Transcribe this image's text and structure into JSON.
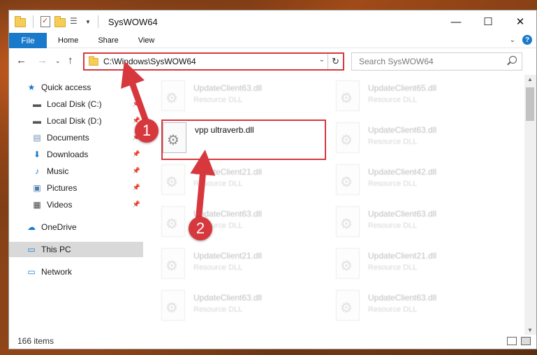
{
  "window": {
    "title": "SysWOW64"
  },
  "ribbon": {
    "tabs": [
      "File",
      "Home",
      "Share",
      "View"
    ]
  },
  "address": {
    "path": "C:\\Windows\\SysWOW64",
    "search_placeholder": "Search SysWOW64"
  },
  "nav": {
    "quick_access": "Quick access",
    "items": [
      "Local Disk (C:)",
      "Local Disk (D:)",
      "Documents",
      "Downloads",
      "Music",
      "Pictures",
      "Videos"
    ],
    "onedrive": "OneDrive",
    "this_pc": "This PC",
    "network": "Network"
  },
  "files": {
    "highlighted": {
      "name": "vpp ultraverb.dll"
    },
    "left": [
      {
        "name": "UpdateClient63.dll",
        "type": "Resource DLL"
      },
      {
        "name": "UpdateClient21.dll",
        "type": "Resource DLL"
      },
      {
        "name": "UpdateClient63.dll",
        "type": "Resource DLL"
      },
      {
        "name": "UpdateClient21.dll",
        "type": "Resource DLL"
      },
      {
        "name": "UpdateClient63.dll",
        "type": "Resource DLL"
      }
    ],
    "right": [
      {
        "name": "UpdateClient65.dll",
        "type": "Resource DLL"
      },
      {
        "name": "UpdateClient63.dll",
        "type": "Resource DLL"
      },
      {
        "name": "UpdateClient42.dll",
        "type": "Resource DLL"
      },
      {
        "name": "UpdateClient63.dll",
        "type": "Resource DLL"
      },
      {
        "name": "UpdateClient21.dll",
        "type": "Resource DLL"
      },
      {
        "name": "UpdateClient63.dll",
        "type": "Resource DLL"
      }
    ]
  },
  "status": {
    "count": "166 items"
  },
  "annotations": {
    "step1": "1",
    "step2": "2"
  },
  "colors": {
    "accent": "#1979ca",
    "highlight": "#d6383e"
  }
}
